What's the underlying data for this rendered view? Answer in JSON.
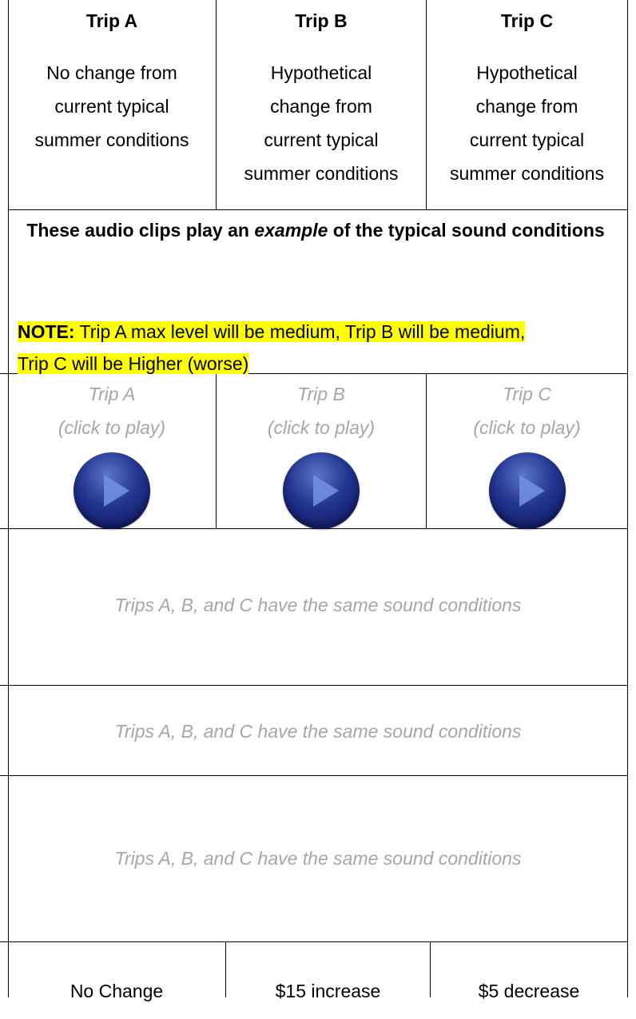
{
  "trips": [
    {
      "title": "Trip A",
      "desc": [
        "No change from",
        "current typical",
        "summer conditions"
      ]
    },
    {
      "title": "Trip B",
      "desc": [
        "Hypothetical",
        "change from",
        "current typical",
        "summer conditions"
      ]
    },
    {
      "title": "Trip C",
      "desc": [
        "Hypothetical",
        "change from",
        "current typical",
        "summer conditions"
      ]
    }
  ],
  "audio": {
    "heading_pre": "These audio clips play an ",
    "heading_em": "example",
    "heading_post": " of the typical sound conditions",
    "note_label": "NOTE:",
    "note_text_1": " Trip A max level will be medium, Trip B will be medium,",
    "note_text_2": "Trip C will be Higher (worse)"
  },
  "clips": [
    {
      "label": "Trip A",
      "hint": "(click to play)"
    },
    {
      "label": "Trip B",
      "hint": "(click to play)"
    },
    {
      "label": "Trip C",
      "hint": "(click to play)"
    }
  ],
  "same_rows": [
    "Trips A, B, and C have the same sound conditions",
    "Trips A, B, and C have the same sound conditions",
    "Trips A, B, and C have the same sound conditions"
  ],
  "costs": [
    "No Change",
    "$15 increase",
    "$5 decrease"
  ],
  "colors": {
    "highlight": "#ffff00",
    "muted_text": "#a6a6a6",
    "play_button": "#22348f"
  }
}
